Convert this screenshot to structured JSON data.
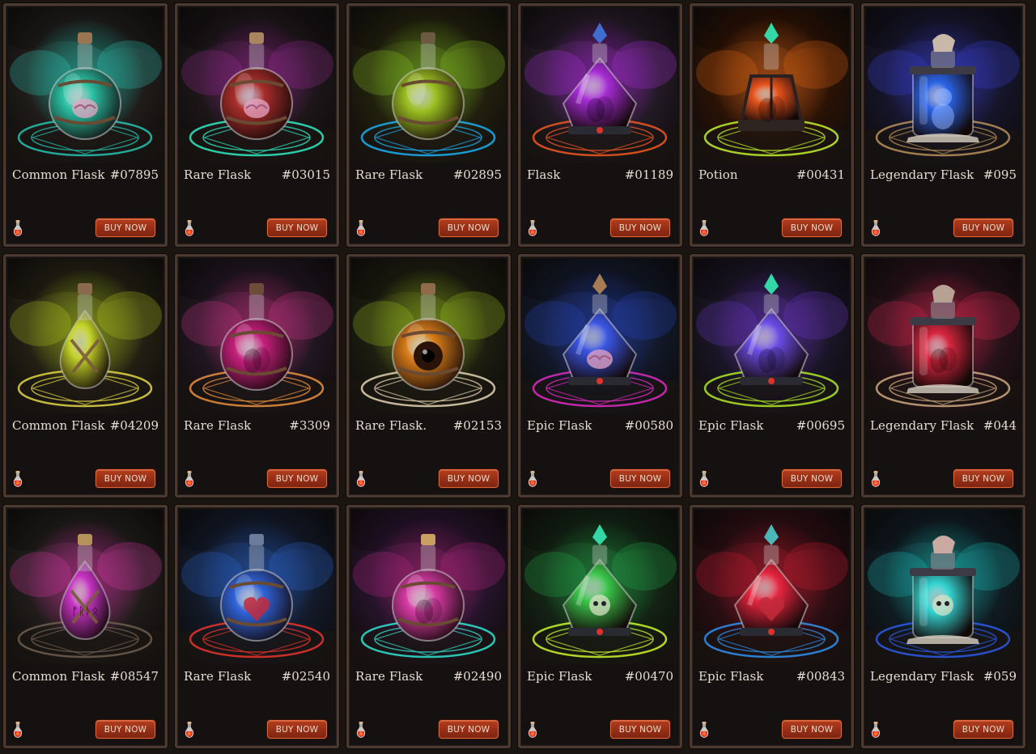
{
  "buy_label": "BUY NOW",
  "cards": [
    {
      "name": "Common Flask",
      "id": "#07895",
      "bg": "#1f1c1a",
      "smoke": "#2fd8c4",
      "liquid": "#2ac1a4",
      "circle": "#25b8a8",
      "shape": "round",
      "cap": "#9b7452",
      "contents": "brain-icon"
    },
    {
      "name": "Rare Flask",
      "id": "#03015",
      "bg": "#1c1619",
      "smoke": "#a02a9a",
      "liquid": "#a82d2a",
      "circle": "#2de0b8",
      "shape": "round",
      "cap": "#a8865f",
      "contents": "brain-icon"
    },
    {
      "name": "Rare Flask",
      "id": "#02895",
      "bg": "#21200e",
      "smoke": "#8fd122",
      "liquid": "#9bc021",
      "circle": "#1ba7e8",
      "shape": "round",
      "cap": "#6d5a43",
      "contents": "none"
    },
    {
      "name": "Flask",
      "id": "#01189",
      "bg": "#221a24",
      "smoke": "#b42ee6",
      "liquid": "#a72cd6",
      "circle": "#e6541f",
      "shape": "diamond",
      "cap": "#3f6ed0",
      "contents": "organ-icon"
    },
    {
      "name": "Potion",
      "id": "#00431",
      "bg": "#2a1206",
      "smoke": "#f06a13",
      "liquid": "#e8531c",
      "circle": "#b8e62c",
      "shape": "lantern",
      "cap": "#34d7a6",
      "contents": "organ-icon"
    },
    {
      "name": "Legendary Flask",
      "id": "#095",
      "bg": "#16152a",
      "smoke": "#3c42e6",
      "liquid": "#2b64e8",
      "circle": "#b08a57",
      "shape": "jar",
      "cap": "#c9b7a8",
      "contents": "baby-icon"
    },
    {
      "name": "Common Flask",
      "id": "#04209",
      "bg": "#221f13",
      "smoke": "#bad41e",
      "liquid": "#c6d52a",
      "circle": "#d8cb44",
      "shape": "teardrop",
      "cap": "#8a6a4c",
      "contents": "none"
    },
    {
      "name": "Rare Flask",
      "id": "#3309",
      "bg": "#201620",
      "smoke": "#d9368f",
      "liquid": "#c51f7b",
      "circle": "#e08a3a",
      "shape": "round",
      "cap": "#6d4c38",
      "contents": "organ-icon"
    },
    {
      "name": "Rare Flask.",
      "id": "#02153",
      "bg": "#1d1d10",
      "smoke": "#a5cc1e",
      "liquid": "#d87c18",
      "circle": "#d8c9a8",
      "shape": "round",
      "cap": "#8f6b4b",
      "contents": "eye-icon"
    },
    {
      "name": "Epic Flask",
      "id": "#00580",
      "bg": "#121828",
      "smoke": "#2747c9",
      "liquid": "#3a55e3",
      "circle": "#d429b8",
      "shape": "diamond",
      "cap": "#a87b54",
      "contents": "brain-icon"
    },
    {
      "name": "Epic Flask",
      "id": "#00695",
      "bg": "#1a1526",
      "smoke": "#6f38d0",
      "liquid": "#6a4de6",
      "circle": "#a8de23",
      "shape": "diamond",
      "cap": "#34d7a6",
      "contents": "organ-icon"
    },
    {
      "name": "Legendary Flask",
      "id": "#044",
      "bg": "#26121a",
      "smoke": "#e02650",
      "liquid": "#d8263f",
      "circle": "#c7a07a",
      "shape": "jar",
      "cap": "#b7a193",
      "contents": "organ-icon"
    },
    {
      "name": "Common Flask",
      "id": "#08547",
      "bg": "#1f1c1a",
      "smoke": "#e43bb0",
      "liquid": "#c634c3",
      "circle": "#6b5a4d",
      "shape": "teardrop",
      "cap": "#b4925a",
      "contents": "rune-icon"
    },
    {
      "name": "Rare Flask",
      "id": "#02540",
      "bg": "#131a2a",
      "smoke": "#2b6ce0",
      "liquid": "#2f63d8",
      "circle": "#e0322a",
      "shape": "round",
      "cap": "#6b7b9c",
      "contents": "heart-icon"
    },
    {
      "name": "Rare Flask",
      "id": "#02490",
      "bg": "#25132a",
      "smoke": "#c4298c",
      "liquid": "#d63aa3",
      "circle": "#2fd7c6",
      "shape": "round",
      "cap": "#c9a061",
      "contents": "organ-icon"
    },
    {
      "name": "Epic Flask",
      "id": "#00470",
      "bg": "#132314",
      "smoke": "#25b44e",
      "liquid": "#3ac54a",
      "circle": "#c2ea2a",
      "shape": "diamond",
      "cap": "#34d7a6",
      "contents": "skull-icon"
    },
    {
      "name": "Epic Flask",
      "id": "#00843",
      "bg": "#2a0e13",
      "smoke": "#d61d33",
      "liquid": "#e8253f",
      "circle": "#2f8be6",
      "shape": "diamond",
      "cap": "#4bb8b8",
      "contents": "heart-icon"
    },
    {
      "name": "Legendary Flask",
      "id": "#059",
      "bg": "#0f1b22",
      "smoke": "#1bc2c0",
      "liquid": "#34d6d3",
      "circle": "#2c55e0",
      "shape": "jar",
      "cap": "#c9a9a0",
      "contents": "skull-icon"
    }
  ]
}
